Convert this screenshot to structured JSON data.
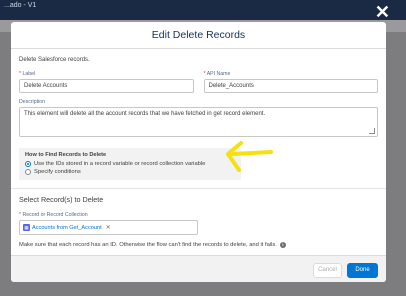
{
  "background": {
    "window_title": "...ado - V1"
  },
  "modal": {
    "title": "Edit Delete Records",
    "description_text": "Delete Salesforce records.",
    "label_field": {
      "label": "Label",
      "value": "Delete Accounts"
    },
    "api_name_field": {
      "label": "API Name",
      "value": "Delete_Accounts"
    },
    "description_field": {
      "label": "Description",
      "value": "This element will delete all the account records that we have fetched in get record element."
    },
    "find_records": {
      "title": "How to Find Records to Delete",
      "options": [
        {
          "label": "Use the IDs stored in a record variable or record collection variable",
          "selected": true
        },
        {
          "label": "Specify conditions",
          "selected": false
        }
      ]
    },
    "select_section": {
      "title": "Select Record(s) to Delete",
      "field_label": "Record or Record Collection",
      "pill_text": "Accounts from Get_Account",
      "note": "Make sure that each record has an ID. Otherwise the flow can't find the records to delete, and it fails."
    },
    "buttons": {
      "cancel": "Cancel",
      "done": "Done"
    }
  },
  "icons": {
    "close": "close-icon",
    "resize": "resize-handle-icon",
    "record": "record-variable-icon",
    "info": "info-icon",
    "annotation": "yellow-arrow-icon"
  },
  "colors": {
    "accent": "#0176d3",
    "annotation_arrow": "#f5e012",
    "top_bar": "#1b2a44"
  }
}
